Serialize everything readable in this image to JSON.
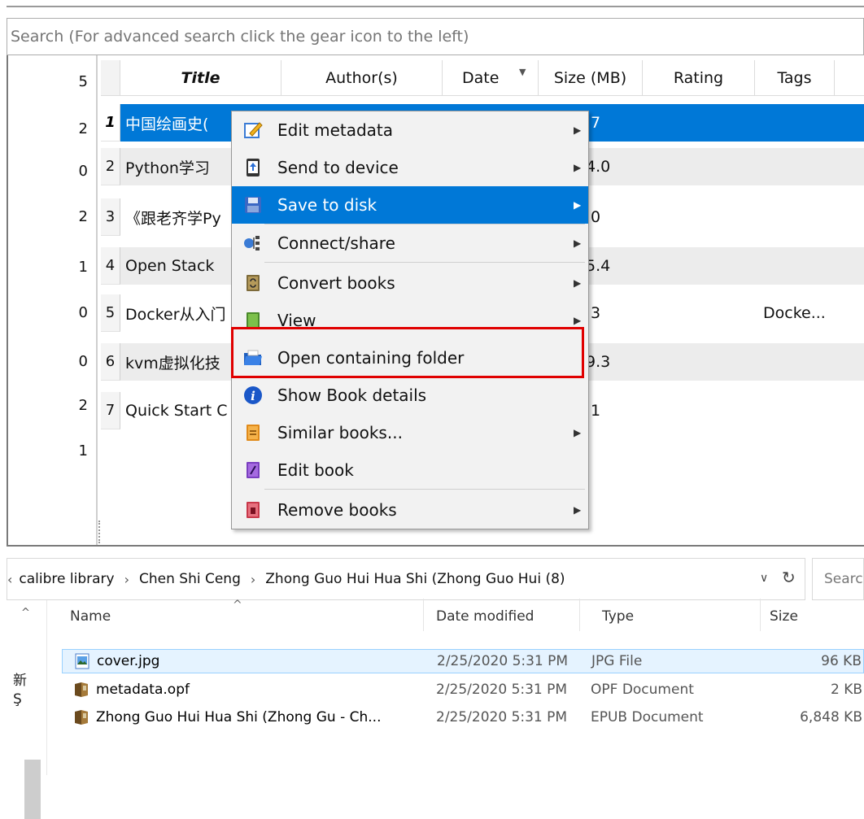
{
  "search": {
    "placeholder": "Search (For advanced search click the gear icon to the left)"
  },
  "tag_counts": [
    "5",
    "2",
    "0",
    "2",
    "1",
    "0",
    "0",
    "2",
    "1"
  ],
  "table": {
    "headers": [
      "Title",
      "Author(s)",
      "Date",
      "Size (MB)",
      "Rating",
      "Tags"
    ],
    "rows": [
      {
        "num": "1",
        "title": "中国绘画史(",
        "size": ".7",
        "tags": ""
      },
      {
        "num": "2",
        "title": "Python学习",
        "size": "4.0",
        "tags": ""
      },
      {
        "num": "3",
        "title": "《跟老齐学Py",
        "size": ".0",
        "tags": ""
      },
      {
        "num": "4",
        "title": "Open Stack",
        "size": "5.4",
        "tags": ""
      },
      {
        "num": "5",
        "title": "Docker从入门",
        "size": ".3",
        "tags": "Docke..."
      },
      {
        "num": "6",
        "title": "kvm虚拟化技",
        "size": "9.3",
        "tags": ""
      },
      {
        "num": "7",
        "title": "Quick Start C",
        "size": ".1",
        "tags": ""
      }
    ]
  },
  "context_menu": {
    "items": [
      {
        "label": "Edit metadata",
        "icon": "edit-metadata-icon",
        "submenu": true
      },
      {
        "label": "Send to device",
        "icon": "send-to-device-icon",
        "submenu": true
      },
      {
        "label": "Save to disk",
        "icon": "save-to-disk-icon",
        "submenu": true
      },
      {
        "label": "Connect/share",
        "icon": "connect-share-icon",
        "submenu": true
      },
      {
        "label": "Convert books",
        "icon": "convert-books-icon",
        "submenu": true
      },
      {
        "label": "View",
        "icon": "view-icon",
        "submenu": true
      },
      {
        "label": "Open containing folder",
        "icon": "folder-icon",
        "submenu": false
      },
      {
        "label": "Show Book details",
        "icon": "info-icon",
        "submenu": false
      },
      {
        "label": "Similar books...",
        "icon": "similar-books-icon",
        "submenu": true
      },
      {
        "label": "Edit book",
        "icon": "edit-book-icon",
        "submenu": false
      },
      {
        "label": "Remove books",
        "icon": "remove-books-icon",
        "submenu": true
      }
    ],
    "highlighted": "Save to disk",
    "callout": "Open containing folder"
  },
  "explorer": {
    "breadcrumb": [
      "calibre library",
      "Chen Shi Ceng",
      "Zhong Guo Hui Hua Shi (Zhong Guo Hui (8)"
    ],
    "search_placeholder": "Search",
    "columns": [
      "Name",
      "Date modified",
      "Type",
      "Size"
    ],
    "files": [
      {
        "name": "cover.jpg",
        "date": "2/25/2020 5:31 PM",
        "type": "JPG File",
        "size": "96 KB",
        "icon": "image-file-icon"
      },
      {
        "name": "metadata.opf",
        "date": "2/25/2020 5:31 PM",
        "type": "OPF Document",
        "size": "2 KB",
        "icon": "opf-file-icon"
      },
      {
        "name": "Zhong Guo Hui Hua Shi (Zhong Gu - Ch...",
        "date": "2/25/2020 5:31 PM",
        "type": "EPUB Document",
        "size": "6,848 KB",
        "icon": "epub-file-icon"
      }
    ],
    "nav_fragments": [
      "新",
      "Ş"
    ]
  },
  "colors": {
    "selection": "#0078d7",
    "highlight_box": "#e00000",
    "menu_bg": "#f2f2f2"
  }
}
